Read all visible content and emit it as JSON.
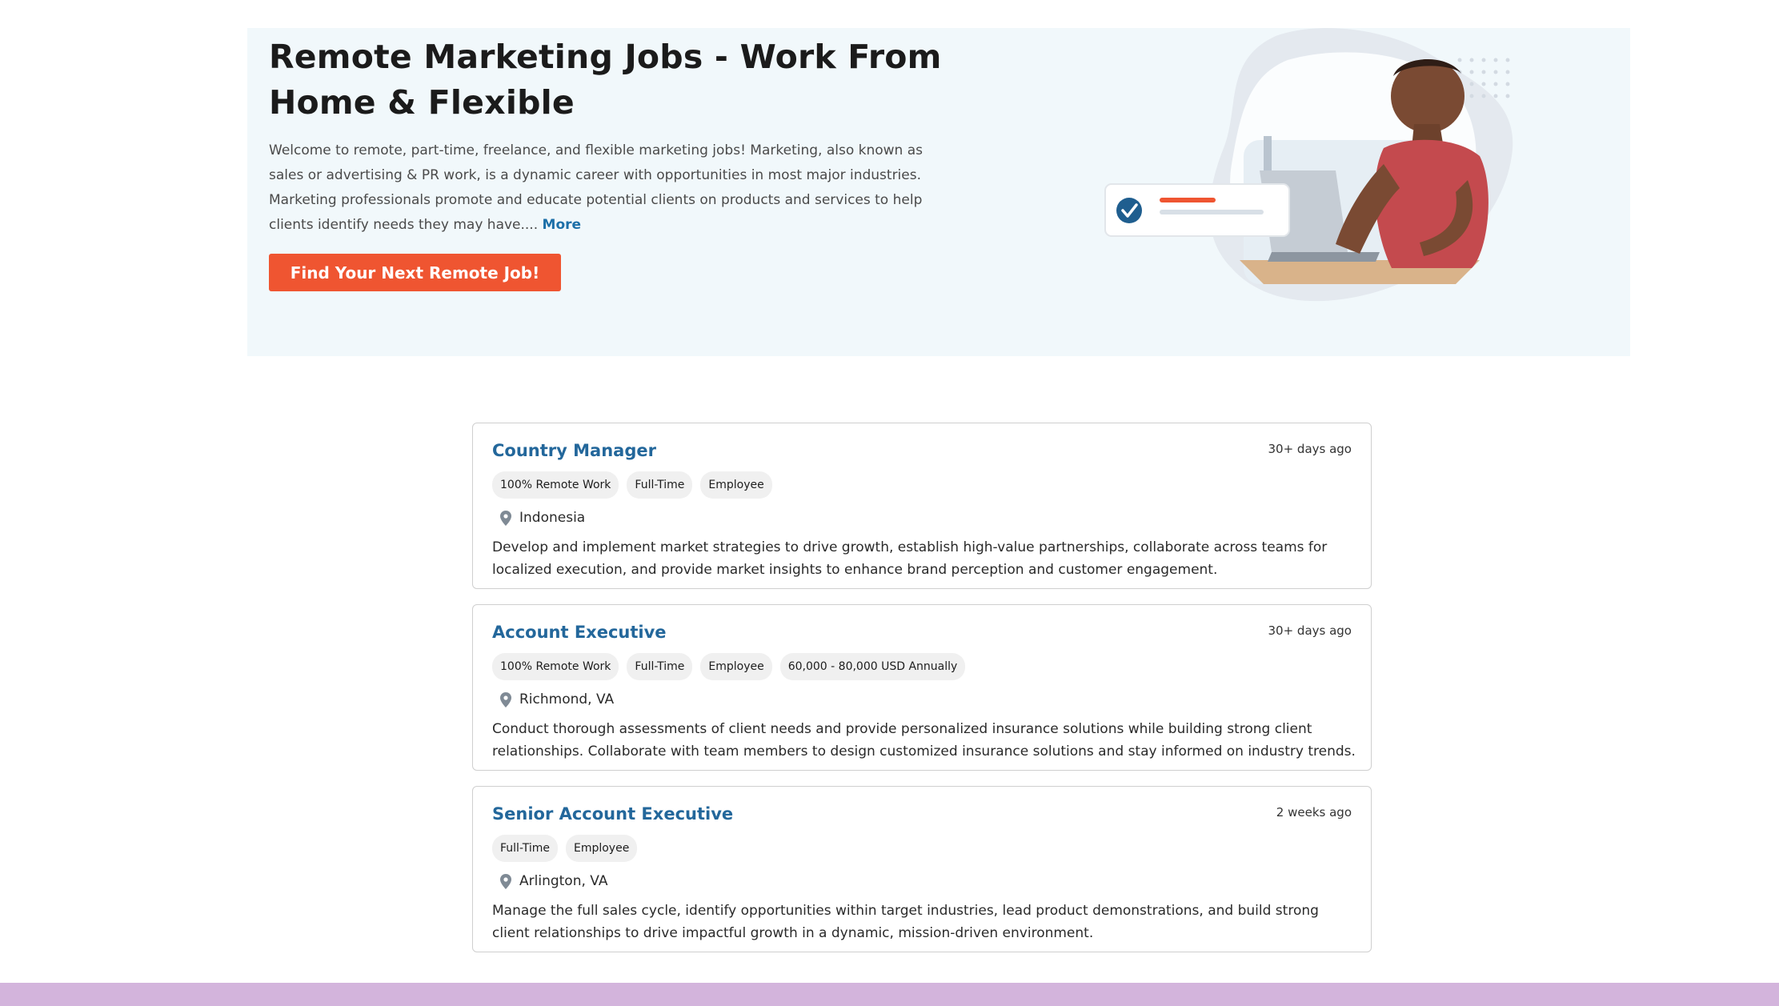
{
  "hero": {
    "title": "Remote Marketing Jobs - Work From Home & Flexible",
    "description": "Welcome to remote, part-time, freelance, and flexible marketing jobs! Marketing, also known as sales or advertising & PR work, is a dynamic career with opportunities in most major industries. Marketing professionals promote and educate potential clients on products and services to help clients identify needs they may have....",
    "more_label": "More",
    "cta_label": "Find Your Next Remote Job!",
    "illustration_icon": "person-working-on-laptop-illustration",
    "colors": {
      "background": "#f1f8fb",
      "cta": "#ef5531",
      "link": "#1c6fa8"
    }
  },
  "jobs": [
    {
      "title": "Country Manager",
      "age": "30+ days ago",
      "tags": [
        "100% Remote Work",
        "Full-Time",
        "Employee"
      ],
      "location": "Indonesia",
      "description": "Develop and implement market strategies to drive growth, establish high-value partnerships, collaborate across teams for localized execution, and provide market insights to enhance brand perception and customer engagement."
    },
    {
      "title": "Account Executive",
      "age": "30+ days ago",
      "tags": [
        "100% Remote Work",
        "Full-Time",
        "Employee",
        "60,000 - 80,000 USD Annually"
      ],
      "location": "Richmond, VA",
      "description": "Conduct thorough assessments of client needs and provide personalized insurance solutions while building strong client relationships. Collaborate with team members to design customized insurance solutions and stay informed on industry trends."
    },
    {
      "title": "Senior Account Executive",
      "age": "2 weeks ago",
      "tags": [
        "Full-Time",
        "Employee"
      ],
      "location": "Arlington, VA",
      "description": "Manage the full sales cycle, identify opportunities within target industries, lead product demonstrations, and build strong client relationships to drive impactful growth in a dynamic, mission-driven environment."
    }
  ],
  "colors": {
    "job_title": "#23679b",
    "footer_band": "#d3b4dc"
  }
}
